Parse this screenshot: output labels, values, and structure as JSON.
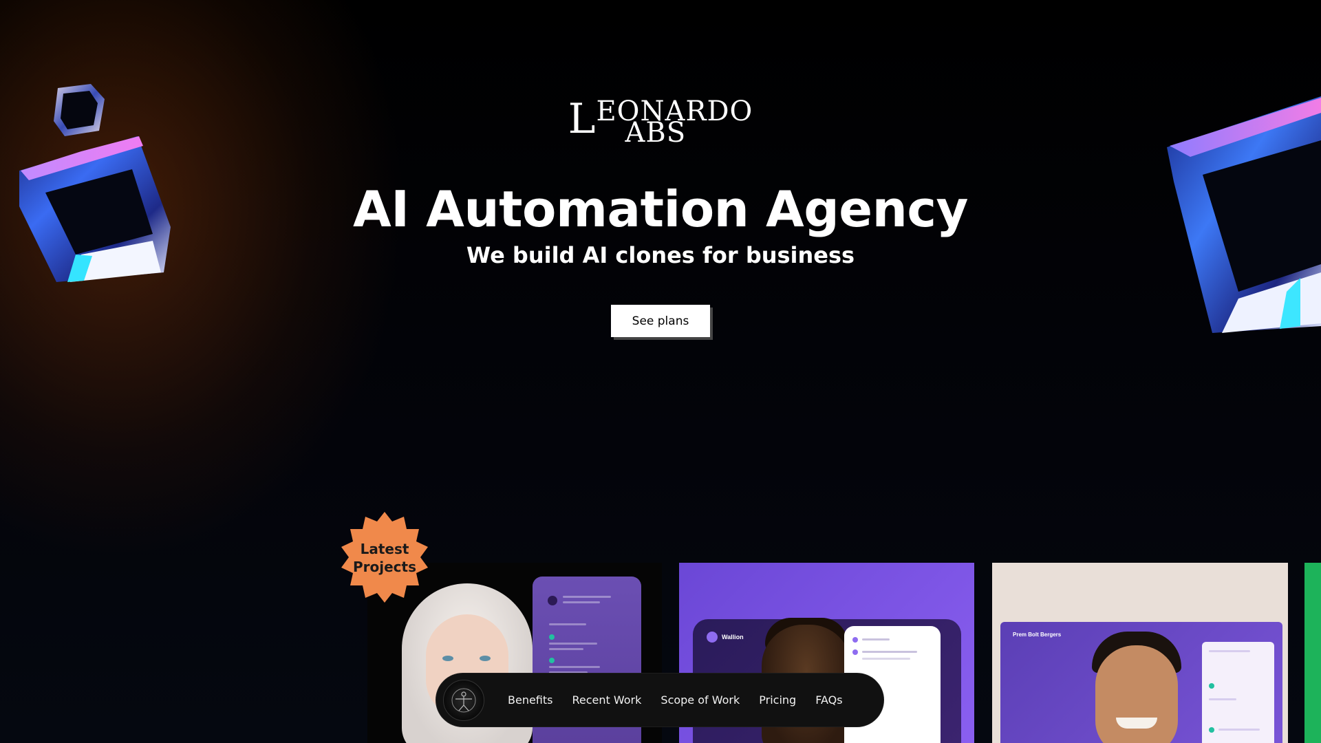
{
  "logo": {
    "line1": "LEONARDO",
    "line2": "LABS",
    "line1_display_rest": "EONARDO",
    "line2_display_rest": "ABS"
  },
  "hero": {
    "title": "AI Automation Agency",
    "subtitle": "We build AI clones for business",
    "cta_label": "See plans"
  },
  "badge": {
    "line1": "Latest",
    "line2": "Projects",
    "color": "#f0894b"
  },
  "cards": [
    {
      "id": "project-1",
      "accent": "#6b4fb3"
    },
    {
      "id": "project-2",
      "app_name": "Wallion",
      "accent": "#7b55e6"
    },
    {
      "id": "project-3",
      "app_name": "Prem Bolt Bergers",
      "accent": "#5b3fb5"
    },
    {
      "id": "project-4",
      "accent": "#1db35a"
    }
  ],
  "nav": {
    "items": [
      {
        "label": "Benefits"
      },
      {
        "label": "Recent Work"
      },
      {
        "label": "Scope of Work"
      },
      {
        "label": "Pricing"
      },
      {
        "label": "FAQs"
      }
    ]
  },
  "icons": [
    "vitruvian-logo-icon",
    "glass-cube-icon"
  ],
  "colors": {
    "background": "#000000",
    "glow": "#6e3410",
    "cta_bg": "#ffffff",
    "nav_bg": "#111111"
  }
}
